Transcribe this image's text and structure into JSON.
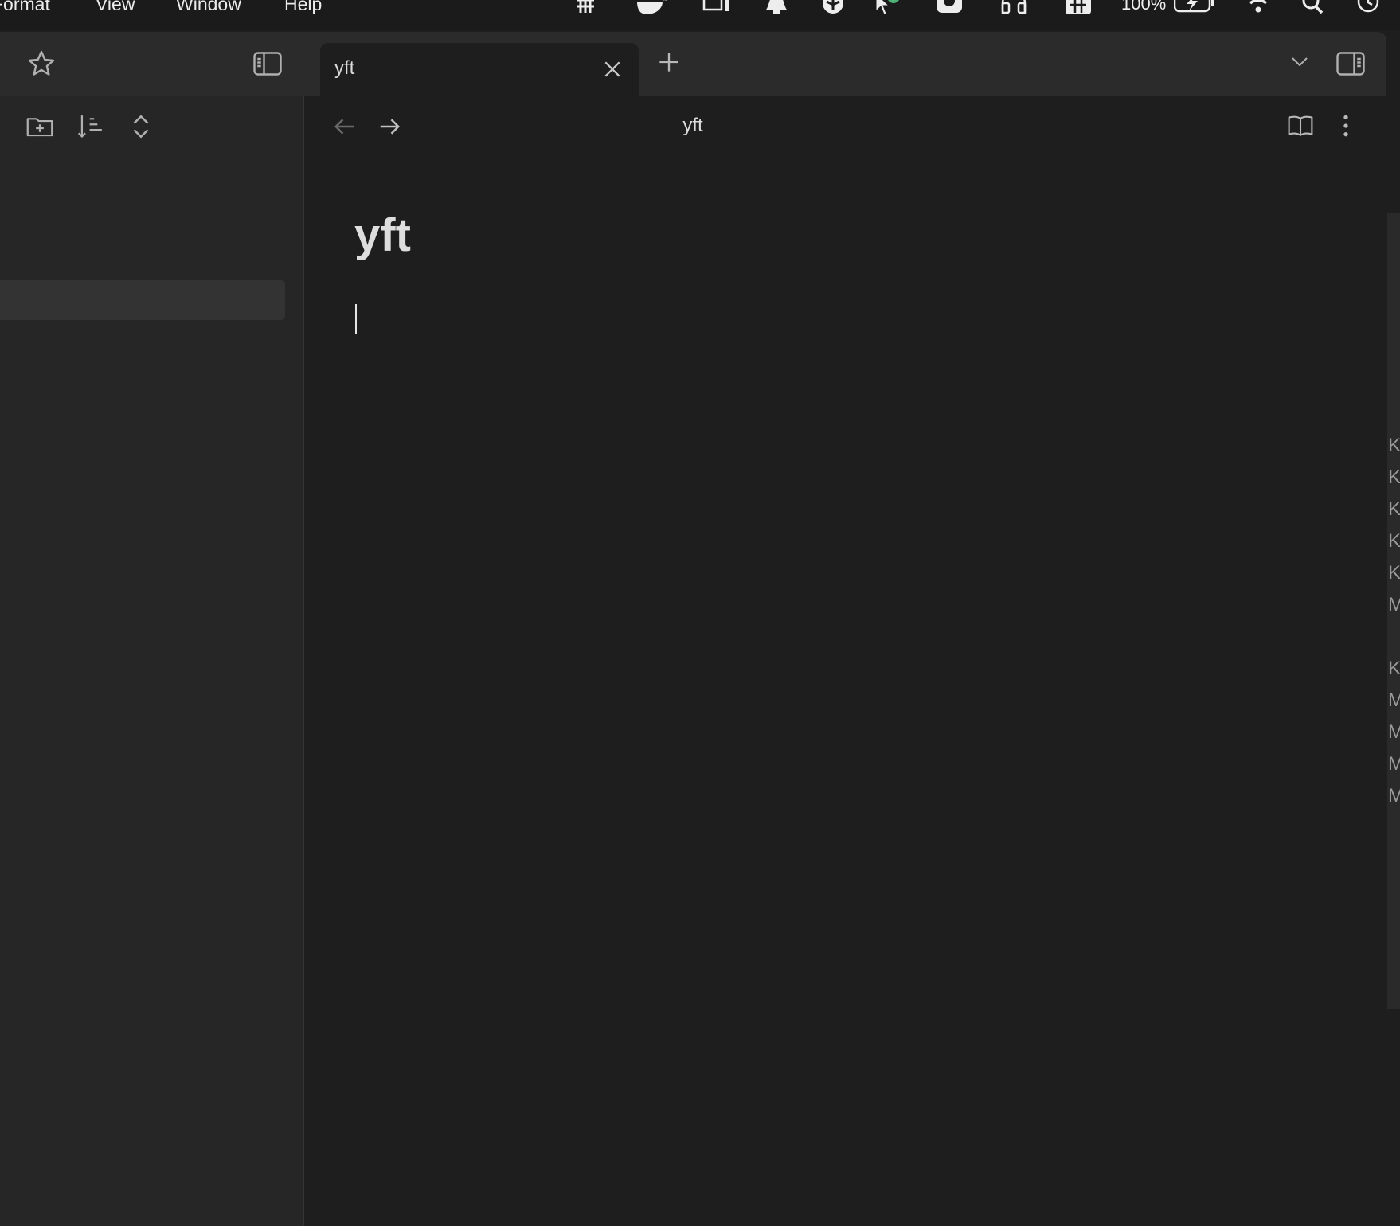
{
  "menubar": {
    "menus": [
      "Format",
      "View",
      "Window",
      "Help"
    ],
    "battery": "100%",
    "tray_icons": [
      "hashtag-icon",
      "docker-icon",
      "display-icon",
      "bell-icon",
      "shield-icon",
      "checkmark-icon",
      "cloud-icon",
      "headphones-icon",
      "input-method-icon",
      "battery-charging-icon",
      "wifi-icon",
      "search-icon",
      "time-machine-icon"
    ]
  },
  "titlebar": {
    "icons": [
      "star-icon",
      "sidebar-toggle-icon",
      "close-icon",
      "plus-icon",
      "chevron-down-icon",
      "right-sidebar-toggle-icon"
    ],
    "tab": {
      "title": "yft"
    }
  },
  "sidebar": {
    "toolbar_icons": [
      "new-folder-icon",
      "sort-icon",
      "expand-collapse-icon"
    ]
  },
  "view": {
    "header_title": "yft",
    "header_icons": [
      "arrow-left-icon",
      "arrow-right-icon",
      "book-open-icon",
      "more-vertical-icon"
    ]
  },
  "note": {
    "title": "yft",
    "body": ""
  },
  "behind_window": {
    "visible_chars": [
      "K",
      "K",
      "K",
      "K",
      "K",
      "M",
      "K",
      "M",
      "M",
      "M",
      "M"
    ]
  },
  "colors": {
    "background": "#1e1e1e",
    "sidebar": "#262626",
    "titlebar": "#2b2b2b",
    "text": "#dcdcdc",
    "accent_check": "#4caf76"
  }
}
